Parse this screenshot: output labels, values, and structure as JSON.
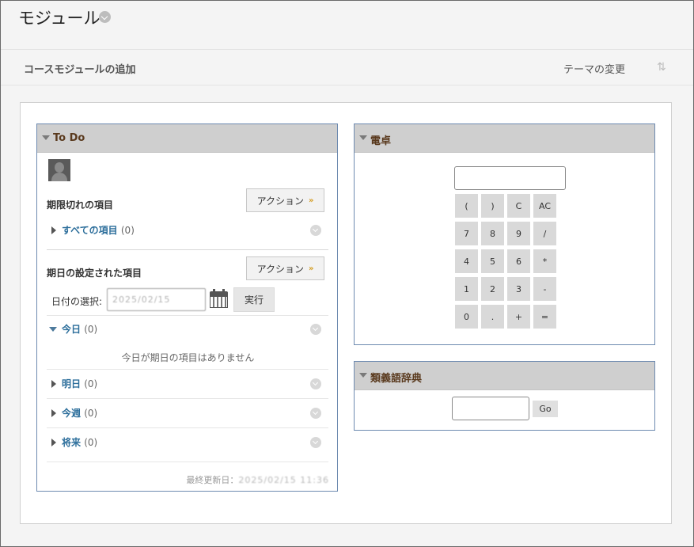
{
  "page": {
    "title": "モジュール"
  },
  "toolbar": {
    "add_module": "コースモジュールの追加",
    "change_theme": "テーマの変更",
    "sort_glyph": "⇅"
  },
  "todo": {
    "title": "To Do",
    "overdue": {
      "label": "期限切れの項目",
      "action": "アクション",
      "all_items": {
        "label": "すべての項目",
        "count": "(0)"
      }
    },
    "due": {
      "label": "期日の設定された項目",
      "action": "アクション",
      "date_select_label": "日付の選択:",
      "date_value": "2025/02/15",
      "go": "実行",
      "rows": [
        {
          "label": "今日",
          "count": "(0)",
          "expanded": true
        },
        {
          "label": "明日",
          "count": "(0)",
          "expanded": false
        },
        {
          "label": "今週",
          "count": "(0)",
          "expanded": false
        },
        {
          "label": "将来",
          "count": "(0)",
          "expanded": false
        }
      ],
      "empty_message": "今日が期日の項目はありません"
    },
    "last_updated_label": "最終更新日：",
    "last_updated_value": "2025/02/15 11:36"
  },
  "calculator": {
    "title": "電卓",
    "keys": [
      "(",
      ")",
      "C",
      "AC",
      "7",
      "8",
      "9",
      "/",
      "4",
      "5",
      "6",
      "*",
      "1",
      "2",
      "3",
      "-",
      "0",
      ".",
      "+",
      "="
    ]
  },
  "thesaurus": {
    "title": "類義語辞典",
    "go": "Go"
  },
  "colors": {
    "module_border": "#6d8ab0",
    "header_bg": "#cfcfcf",
    "link": "#2c6e9b",
    "title_brown": "#5a3a1e"
  }
}
